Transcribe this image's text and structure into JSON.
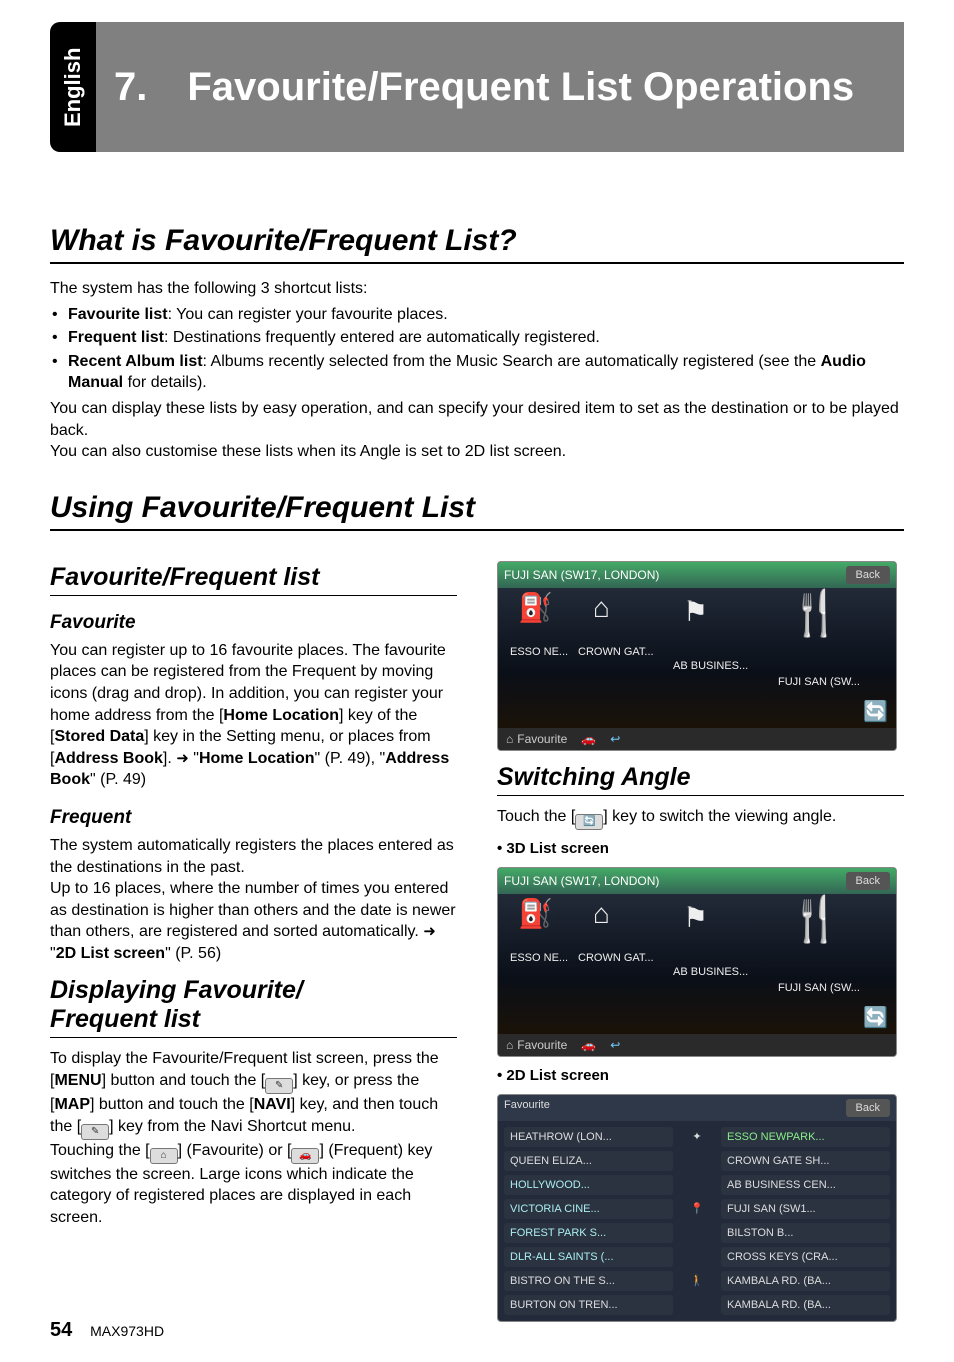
{
  "side_tab": "English",
  "banner": "7. Favourite/Frequent List Operations",
  "sec1": {
    "title": "What is Favourite/Frequent List?",
    "intro": "The system has the following 3 shortcut lists:",
    "bullets": [
      {
        "bold": "Favourite list",
        "rest": ": You can register your favourite places."
      },
      {
        "bold": "Frequent list",
        "rest": ": Destinations frequently entered are automatically registered."
      },
      {
        "bold": "Recent Album list",
        "rest": ": Albums recently selected from the Music Search are automatically registered (see the ",
        "bold2": "Audio Manual",
        "rest2": " for details)."
      }
    ],
    "p1": "You can display these lists by easy operation, and can specify your desired item to set as the destination or to be played back.",
    "p2": "You can also customise these lists when its Angle is set to 2D list screen."
  },
  "sec2": {
    "title": "Using Favourite/Frequent List"
  },
  "left": {
    "h3": "Favourite/Frequent list",
    "fav": {
      "h4": "Favourite",
      "p_a": "You can register up to 16 favourite places. The favourite places can be registered from the Frequent by moving icons (drag and drop). In addition, you can register your home address from the [",
      "home_loc": "Home Location",
      "p_b": "] key of the [",
      "stored": "Stored Data",
      "p_c": "] key in the Setting menu, or places from [",
      "addr": "Address Book",
      "p_d": "]. ",
      "arrow": "➜",
      "ref1": "Home Location",
      "ref1_page": " (P. 49), ",
      "ref2": "Address Book",
      "ref2_page": " (P. 49)"
    },
    "freq": {
      "h4": "Frequent",
      "p1": "The system automatically registers the places entered as the destinations in the past.",
      "p2a": "Up to 16 places, where the number of times you entered as destination is higher than others and the date is newer than others, are registered and sorted automatically. ",
      "arrow": "➜",
      "ref": "2D List screen",
      "ref_page": " (P. 56)"
    },
    "disp": {
      "h3": "Displaying Favourite/\nFrequent list",
      "p_a": "To display the Favourite/Frequent list screen, press the [",
      "menu": "MENU",
      "p_b": "] button and touch the [",
      "p_c": "] key, or press the [",
      "map": "MAP",
      "p_d": "] button and touch the [",
      "navi": "NAVI",
      "p_e": "] key, and then touch the [",
      "p_f": "] key from the Navi Shortcut menu.",
      "p_g": "Touching the [",
      "p_h": "] (Favourite) or [",
      "p_i": "] (Frequent) key switches the screen. Large icons which indicate the category of registered places are displayed in each screen."
    }
  },
  "right": {
    "ss1": {
      "title": "FUJI SAN (SW17, LONDON)",
      "back": "Back",
      "labels": [
        "ESSO NE...",
        "CROWN GAT...",
        "AB BUSINES...",
        "FUJI SAN (SW..."
      ],
      "foot": "Favourite"
    },
    "h3": "Switching Angle",
    "p_a": "Touch the [",
    "p_b": "] key to switch the viewing angle.",
    "bullet1": "3D List screen",
    "bullet2": "2D List screen",
    "ss3": {
      "head_left": "Favourite",
      "back": "Back",
      "rows": [
        [
          "HEATHROW (LON...",
          "ESSO NEWPARK..."
        ],
        [
          "QUEEN ELIZA...",
          "CROWN GATE SH..."
        ],
        [
          "HOLLYWOOD...",
          "AB BUSINESS CEN..."
        ],
        [
          "VICTORIA CINE...",
          "FUJI SAN (SW1..."
        ],
        [
          "FOREST PARK S...",
          "BILSTON B..."
        ],
        [
          "DLR-ALL SAINTS (...",
          "CROSS KEYS (CRA..."
        ],
        [
          "BISTRO ON THE S...",
          "KAMBALA RD. (BA..."
        ],
        [
          "BURTON ON TREN...",
          "KAMBALA RD. (BA..."
        ]
      ]
    }
  },
  "footer": {
    "page": "54",
    "model": "MAX973HD"
  }
}
